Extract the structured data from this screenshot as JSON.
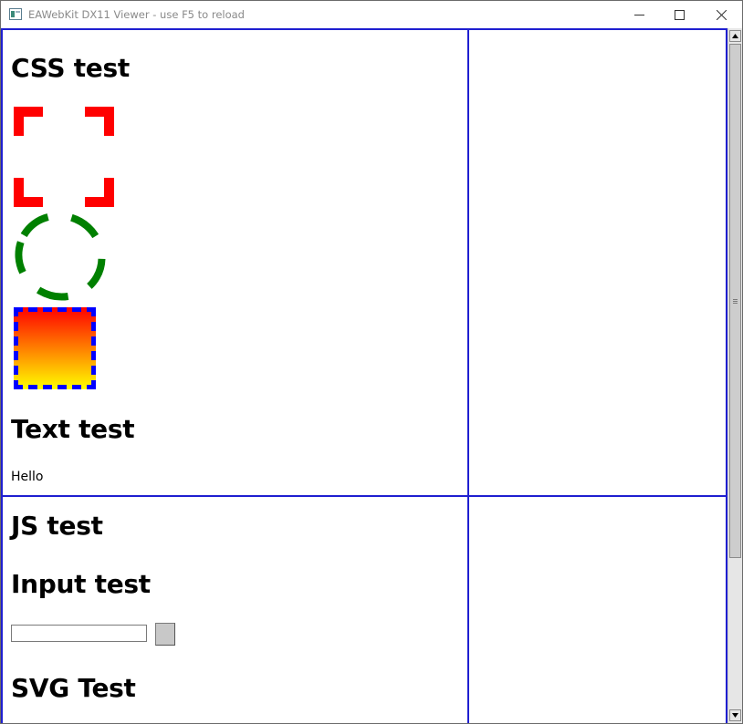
{
  "window": {
    "title": "EAWebKit DX11 Viewer - use F5 to reload",
    "icons": {
      "app": "app-window-icon",
      "minimize": "minimize-icon",
      "maximize": "maximize-icon",
      "close": "close-icon"
    }
  },
  "top_left_pane": {
    "heading_css": "CSS test",
    "heading_text": "Text test",
    "hello_text": "Hello",
    "shapes": {
      "corner_box_color": "#ff0000",
      "dashed_circle_color": "#008000",
      "gradient_box_colors": {
        "top": "#ff0000",
        "bottom": "#ffff00",
        "dash": "#0000ff"
      }
    }
  },
  "bottom_left_pane": {
    "heading_js": "JS test",
    "heading_input": "Input test",
    "input_value": "",
    "heading_svg": "SVG Test"
  },
  "frames": {
    "border_color": "#1f1fd0"
  },
  "scrollbar": {
    "up_icon": "scroll-up-arrow-icon",
    "down_icon": "scroll-down-arrow-icon"
  }
}
